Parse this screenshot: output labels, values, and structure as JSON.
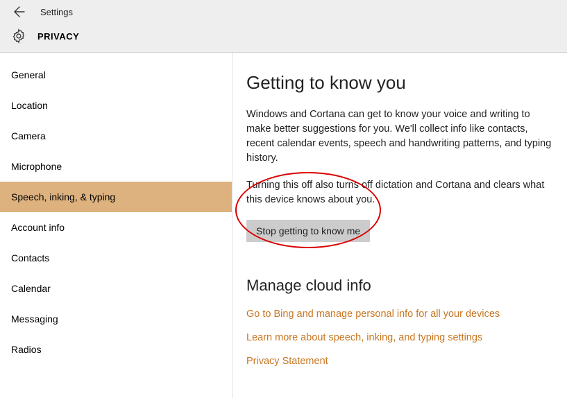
{
  "header": {
    "title": "Settings",
    "section": "PRIVACY"
  },
  "sidebar": {
    "items": [
      {
        "label": "General"
      },
      {
        "label": "Location"
      },
      {
        "label": "Camera"
      },
      {
        "label": "Microphone"
      },
      {
        "label": "Speech, inking, & typing"
      },
      {
        "label": "Account info"
      },
      {
        "label": "Contacts"
      },
      {
        "label": "Calendar"
      },
      {
        "label": "Messaging"
      },
      {
        "label": "Radios"
      }
    ],
    "selected_index": 4
  },
  "content": {
    "heading1": "Getting to know you",
    "para1": "Windows and Cortana can get to know your voice and writing to make better suggestions for you. We'll collect info like contacts, recent calendar events, speech and handwriting patterns, and typing history.",
    "para2": "Turning this off also turns off dictation and Cortana and clears what this device knows about you.",
    "button_label": "Stop getting to know me",
    "heading2": "Manage cloud info",
    "link1": "Go to Bing and manage personal info for all your devices",
    "link2": "Learn more about speech, inking, and typing settings",
    "link3": "Privacy Statement"
  },
  "annotation": {
    "type": "ellipse",
    "color": "#d90000"
  }
}
